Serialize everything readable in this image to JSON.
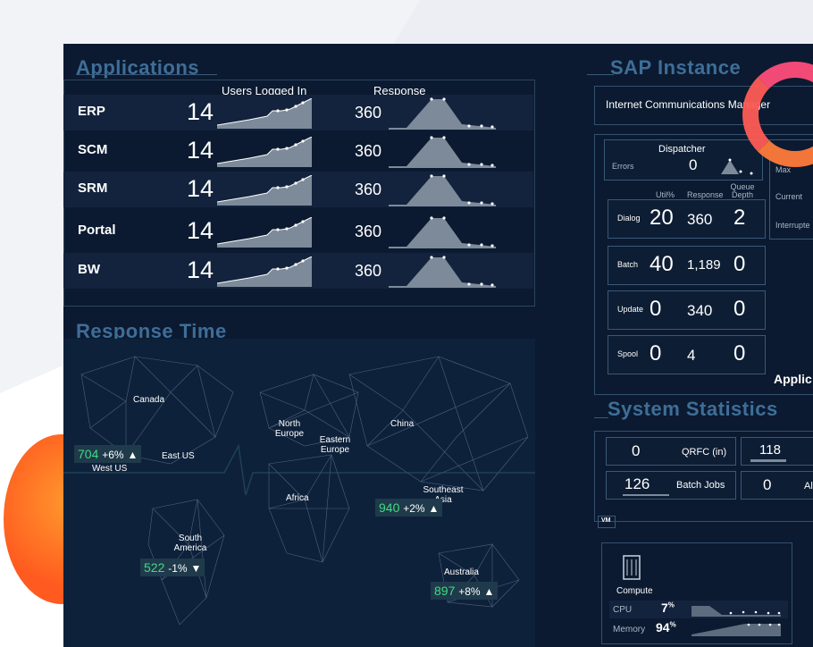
{
  "applications": {
    "title": "Applications",
    "col_users": "Users Logged In",
    "col_response": "Response",
    "rows": [
      {
        "name": "ERP",
        "users": "14",
        "response": "360"
      },
      {
        "name": "SCM",
        "users": "14",
        "response": "360"
      },
      {
        "name": "SRM",
        "users": "14",
        "response": "360"
      },
      {
        "name": "Portal",
        "users": "14",
        "response": "360"
      },
      {
        "name": "BW",
        "users": "14",
        "response": "360"
      }
    ]
  },
  "response_time": {
    "title": "Response Time",
    "regions": {
      "canada": "Canada",
      "west_us": "West US",
      "east_us": "East US",
      "north_europe": "North Europe",
      "eastern_europe": "Eastern Europe",
      "china": "China",
      "africa": "Africa",
      "southeast_asia": "Southeast Asia",
      "south_america": "South America",
      "australia": "Australia"
    },
    "badges": {
      "west_us": {
        "value": "704",
        "change": "+6%"
      },
      "southeast_asia": {
        "value": "940",
        "change": "+2%"
      },
      "south_america": {
        "value": "522",
        "change": "-1%"
      },
      "australia": {
        "value": "897",
        "change": "+8%"
      }
    }
  },
  "sap_instance": {
    "title": "SAP Instance",
    "icm": "Internet Communications Manager",
    "dispatcher": {
      "label": "Dispatcher",
      "errors_label": "Errors",
      "errors": "0"
    },
    "right_labels": {
      "max": "Max",
      "current": "Current",
      "interrupted": "Interrupte"
    },
    "headers": {
      "util": "Util%",
      "response": "Response",
      "queue": "Queue Depth"
    },
    "work_processes": [
      {
        "name": "Dialog",
        "util": "20",
        "response": "360",
        "queue": "2"
      },
      {
        "name": "Batch",
        "util": "40",
        "response": "1,189",
        "queue": "0"
      },
      {
        "name": "Update",
        "util": "0",
        "response": "340",
        "queue": "0"
      },
      {
        "name": "Spool",
        "util": "0",
        "response": "4",
        "queue": "0"
      }
    ],
    "appl_label": "Applic"
  },
  "system_statistics": {
    "title": "System Statistics",
    "qrfc_value": "0",
    "qrfc_label": "QRFC (in)",
    "v118": "118",
    "batch_value": "126",
    "batch_label": "Batch Jobs",
    "v0": "0",
    "al_label": "Al"
  },
  "vm": {
    "tag": "VM",
    "compute_label": "Compute",
    "cpu_label": "CPU",
    "cpu_value": "7",
    "memory_label": "Memory",
    "memory_value": "94",
    "pct": "%"
  }
}
